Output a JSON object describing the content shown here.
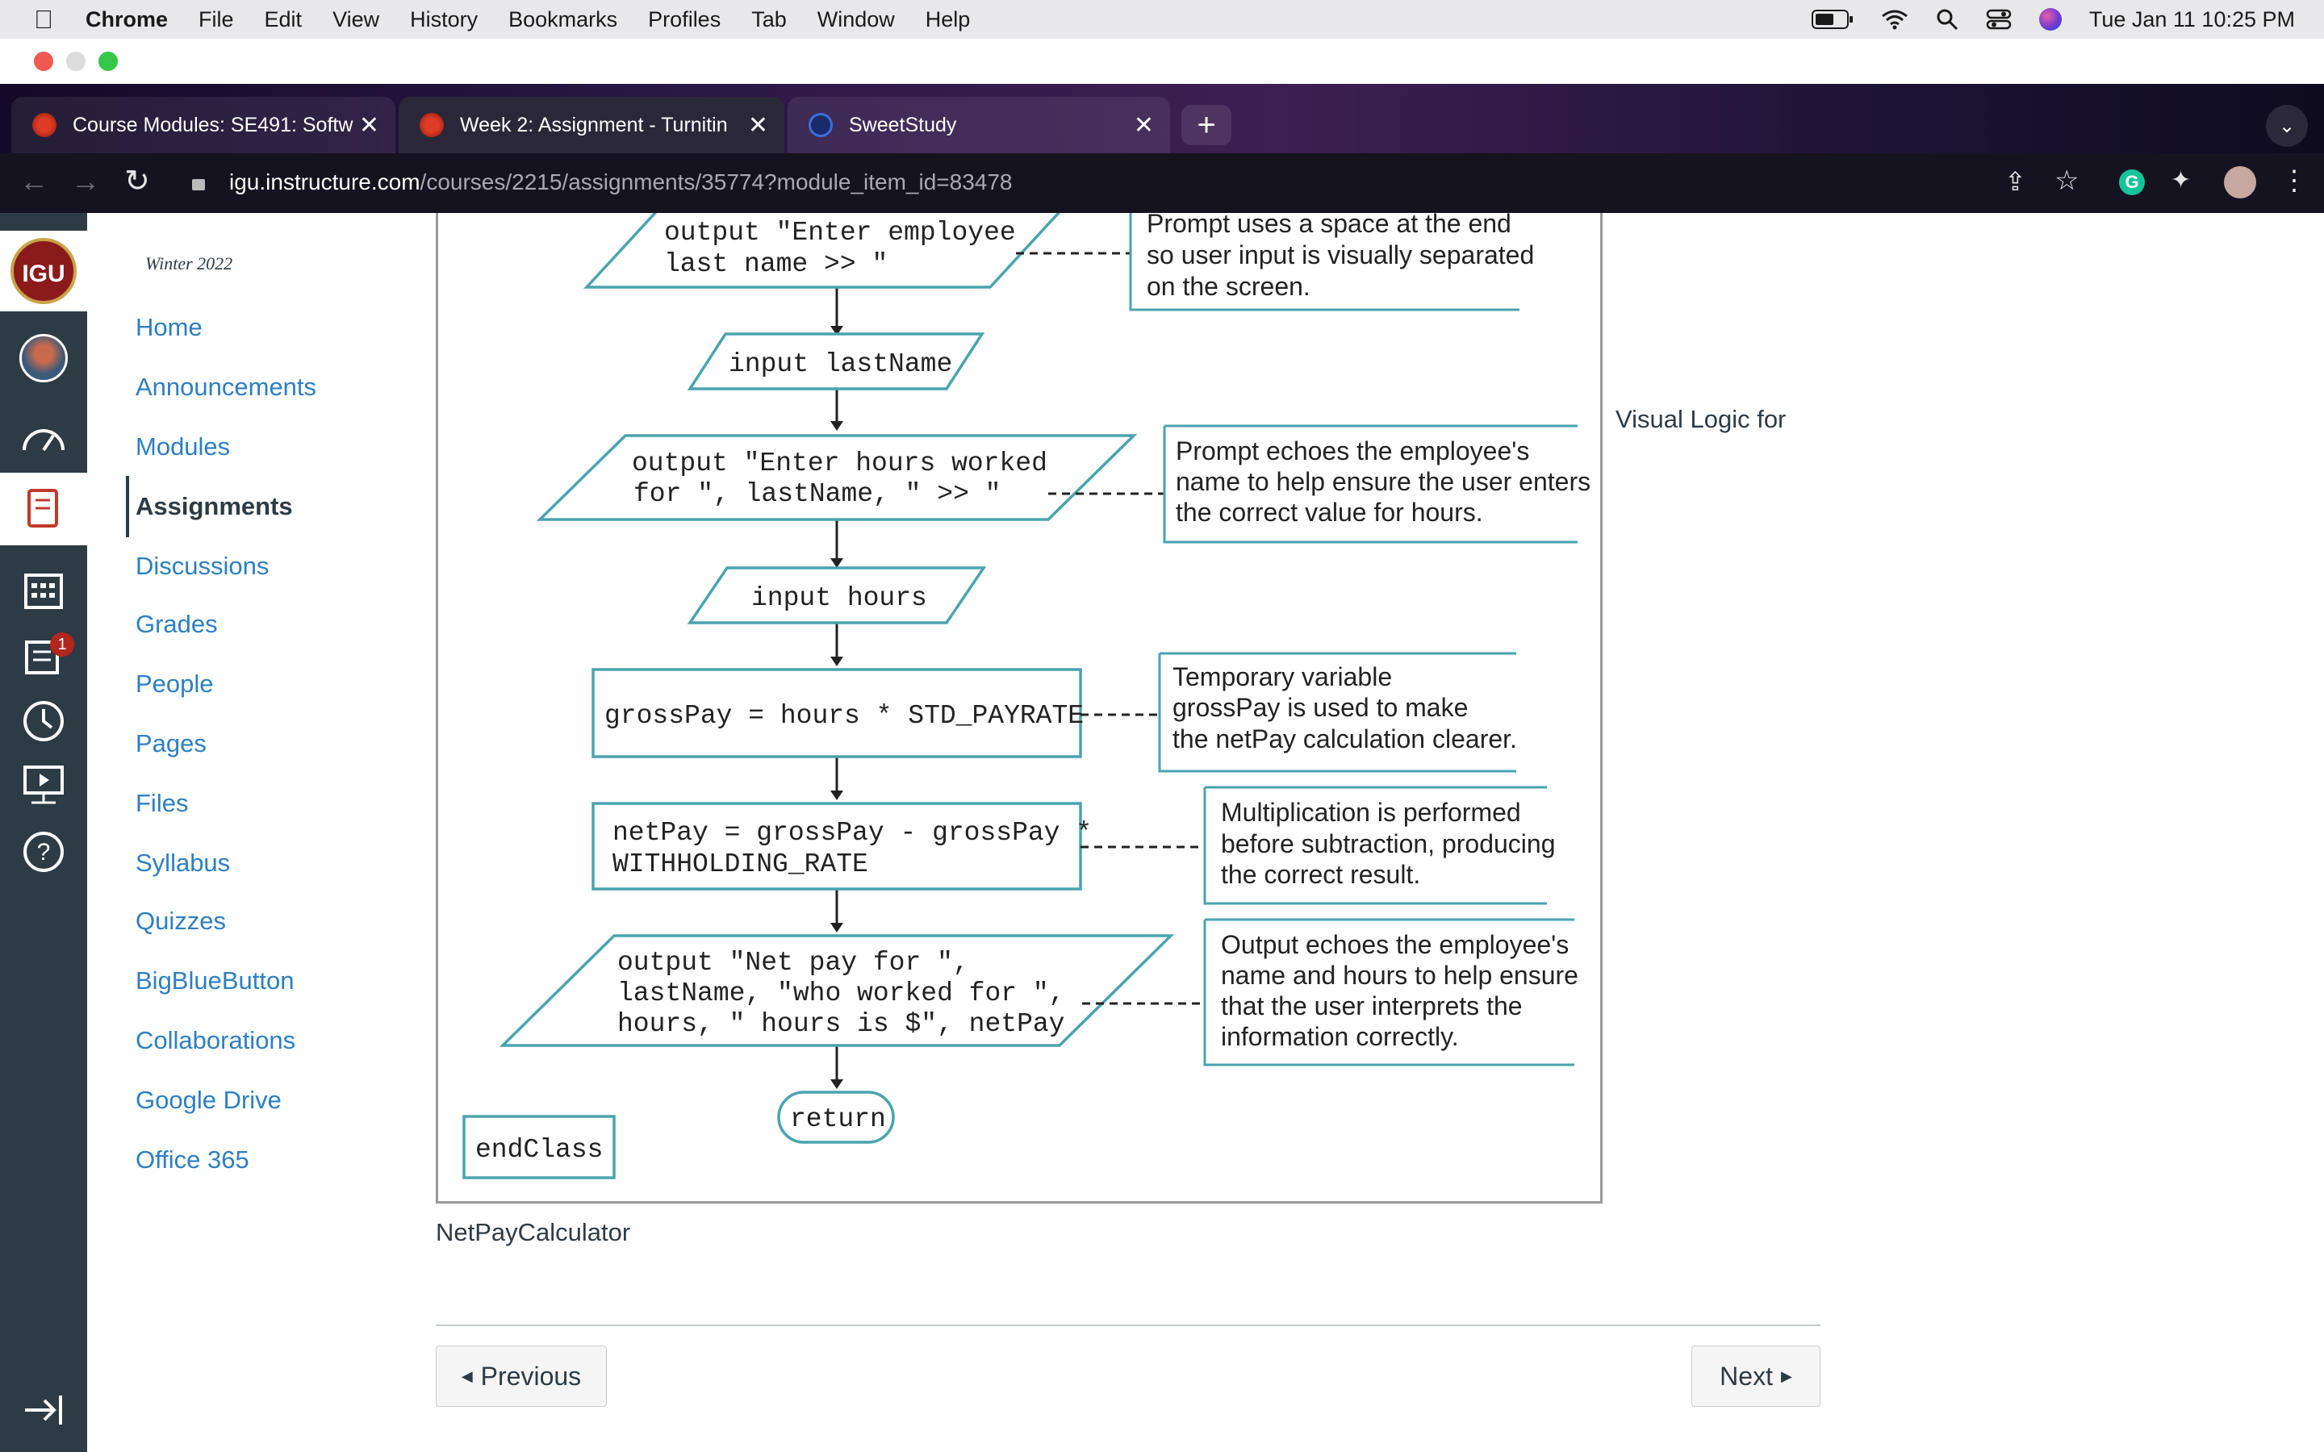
{
  "menubar": {
    "app": "Chrome",
    "items": [
      "File",
      "Edit",
      "View",
      "History",
      "Bookmarks",
      "Profiles",
      "Tab",
      "Window",
      "Help"
    ],
    "datetime": "Tue Jan 11  10:25 PM"
  },
  "tabs": [
    {
      "title": "Course Modules: SE491: Softw"
    },
    {
      "title": "Week 2: Assignment - Turnitin"
    },
    {
      "title": "SweetStudy"
    }
  ],
  "address": {
    "domain": "igu.instructure.com",
    "path": "/courses/2215/assignments/35774?module_item_id=83478"
  },
  "course": {
    "logo": "IGU",
    "term": "Winter 2022",
    "nav": [
      "Home",
      "Announcements",
      "Modules",
      "Assignments",
      "Discussions",
      "Grades",
      "People",
      "Pages",
      "Files",
      "Syllabus",
      "Quizzes",
      "BigBlueButton",
      "Collaborations",
      "Google Drive",
      "Office 365"
    ],
    "active": "Assignments",
    "inbox_badge": "1"
  },
  "flowchart": {
    "steps": [
      {
        "line1": "output \"Enter employee",
        "line2": "last name >> \""
      },
      {
        "line1": "input lastName"
      },
      {
        "line1": "output \"Enter hours worked",
        "line2": "for \", lastName, \" >> \""
      },
      {
        "line1": "input hours"
      },
      {
        "line1": "grossPay = hours * STD_PAYRATE"
      },
      {
        "line1": "netPay = grossPay - grossPay *",
        "line2": "WITHHOLDING_RATE"
      },
      {
        "line1": "output \"Net pay for \",",
        "line2": "lastName, \"who worked for \",",
        "line3": "hours, \" hours is $\", netPay"
      },
      {
        "line1": "return"
      },
      {
        "line1": "endClass"
      }
    ],
    "notes": [
      {
        "l1": "Prompt uses a space at the end",
        "l2": "so user input is visually separated",
        "l3": "on the screen."
      },
      {
        "l1": "Prompt echoes the employee's",
        "l2": "name to help ensure the user enters",
        "l3": "the correct value for hours."
      },
      {
        "l1": "Temporary variable",
        "l2": "grossPay is used to make",
        "l3": "the netPay calculation clearer."
      },
      {
        "l1": "Multiplication is performed",
        "l2": "before subtraction, producing",
        "l3": "the correct result."
      },
      {
        "l1": "Output echoes the employee's",
        "l2": "name and hours to help ensure",
        "l3": "that the user interprets the",
        "l4": "information correctly."
      }
    ]
  },
  "content": {
    "side_text": "Visual Logic for",
    "caption": "NetPayCalculator",
    "prev_label": "Previous",
    "next_label": "Next"
  }
}
